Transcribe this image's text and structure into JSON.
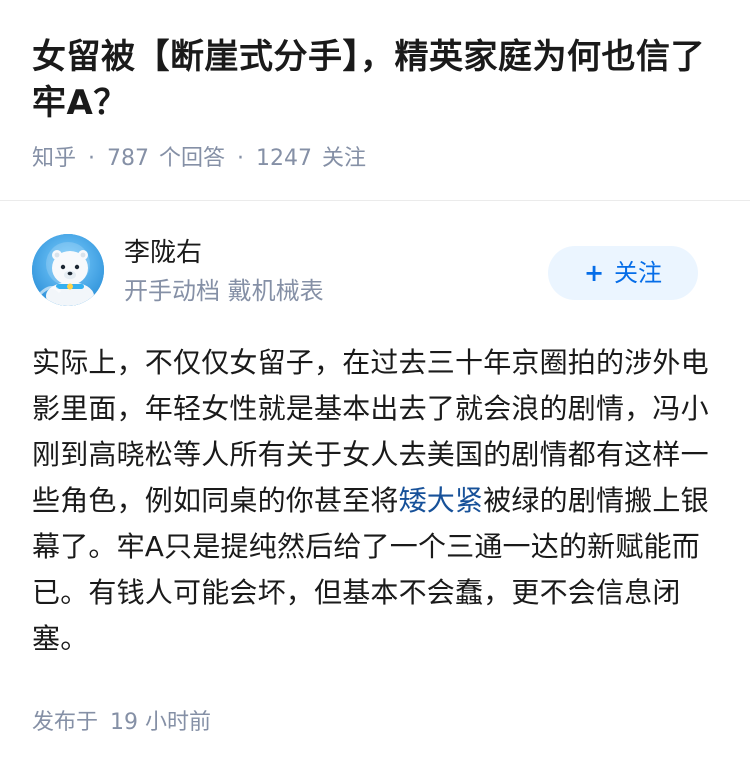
{
  "question": {
    "title": "女留被【断崖式分手】，精英家庭为何也信了牢A？",
    "source": "知乎",
    "answer_count": "787",
    "answer_label": "个回答",
    "follower_count": "1247",
    "follower_label": "关注",
    "separator": "·"
  },
  "author": {
    "name": "李陇右",
    "bio": "开手动档 戴机械表",
    "avatar_icon": "polar-bear-avatar-icon",
    "follow_icon": "plus-icon",
    "follow_symbol": "+",
    "follow_label": "关注"
  },
  "answer": {
    "text_before_link": "实际上，不仅仅女留子，在过去三十年京圈拍的涉外电影里面，年轻女性就是基本出去了就会浪的剧情，冯小刚到高晓松等人所有关于女人去美国的剧情都有这样一些角色，例如同桌的你甚至将",
    "link_text": "矮大紧",
    "text_after_link": "被绿的剧情搬上银幕了。牢A只是提纯然后给了一个三通一达的新赋能而已。有钱人可能会坏，但基本不会蠢，更不会信息闭塞。",
    "publish_label": "发布于",
    "publish_time": "19 小时前"
  },
  "colors": {
    "link": "#175199",
    "follow_text": "#056de8",
    "follow_bg": "#ebf5ff",
    "meta_gray": "#8590a6"
  }
}
